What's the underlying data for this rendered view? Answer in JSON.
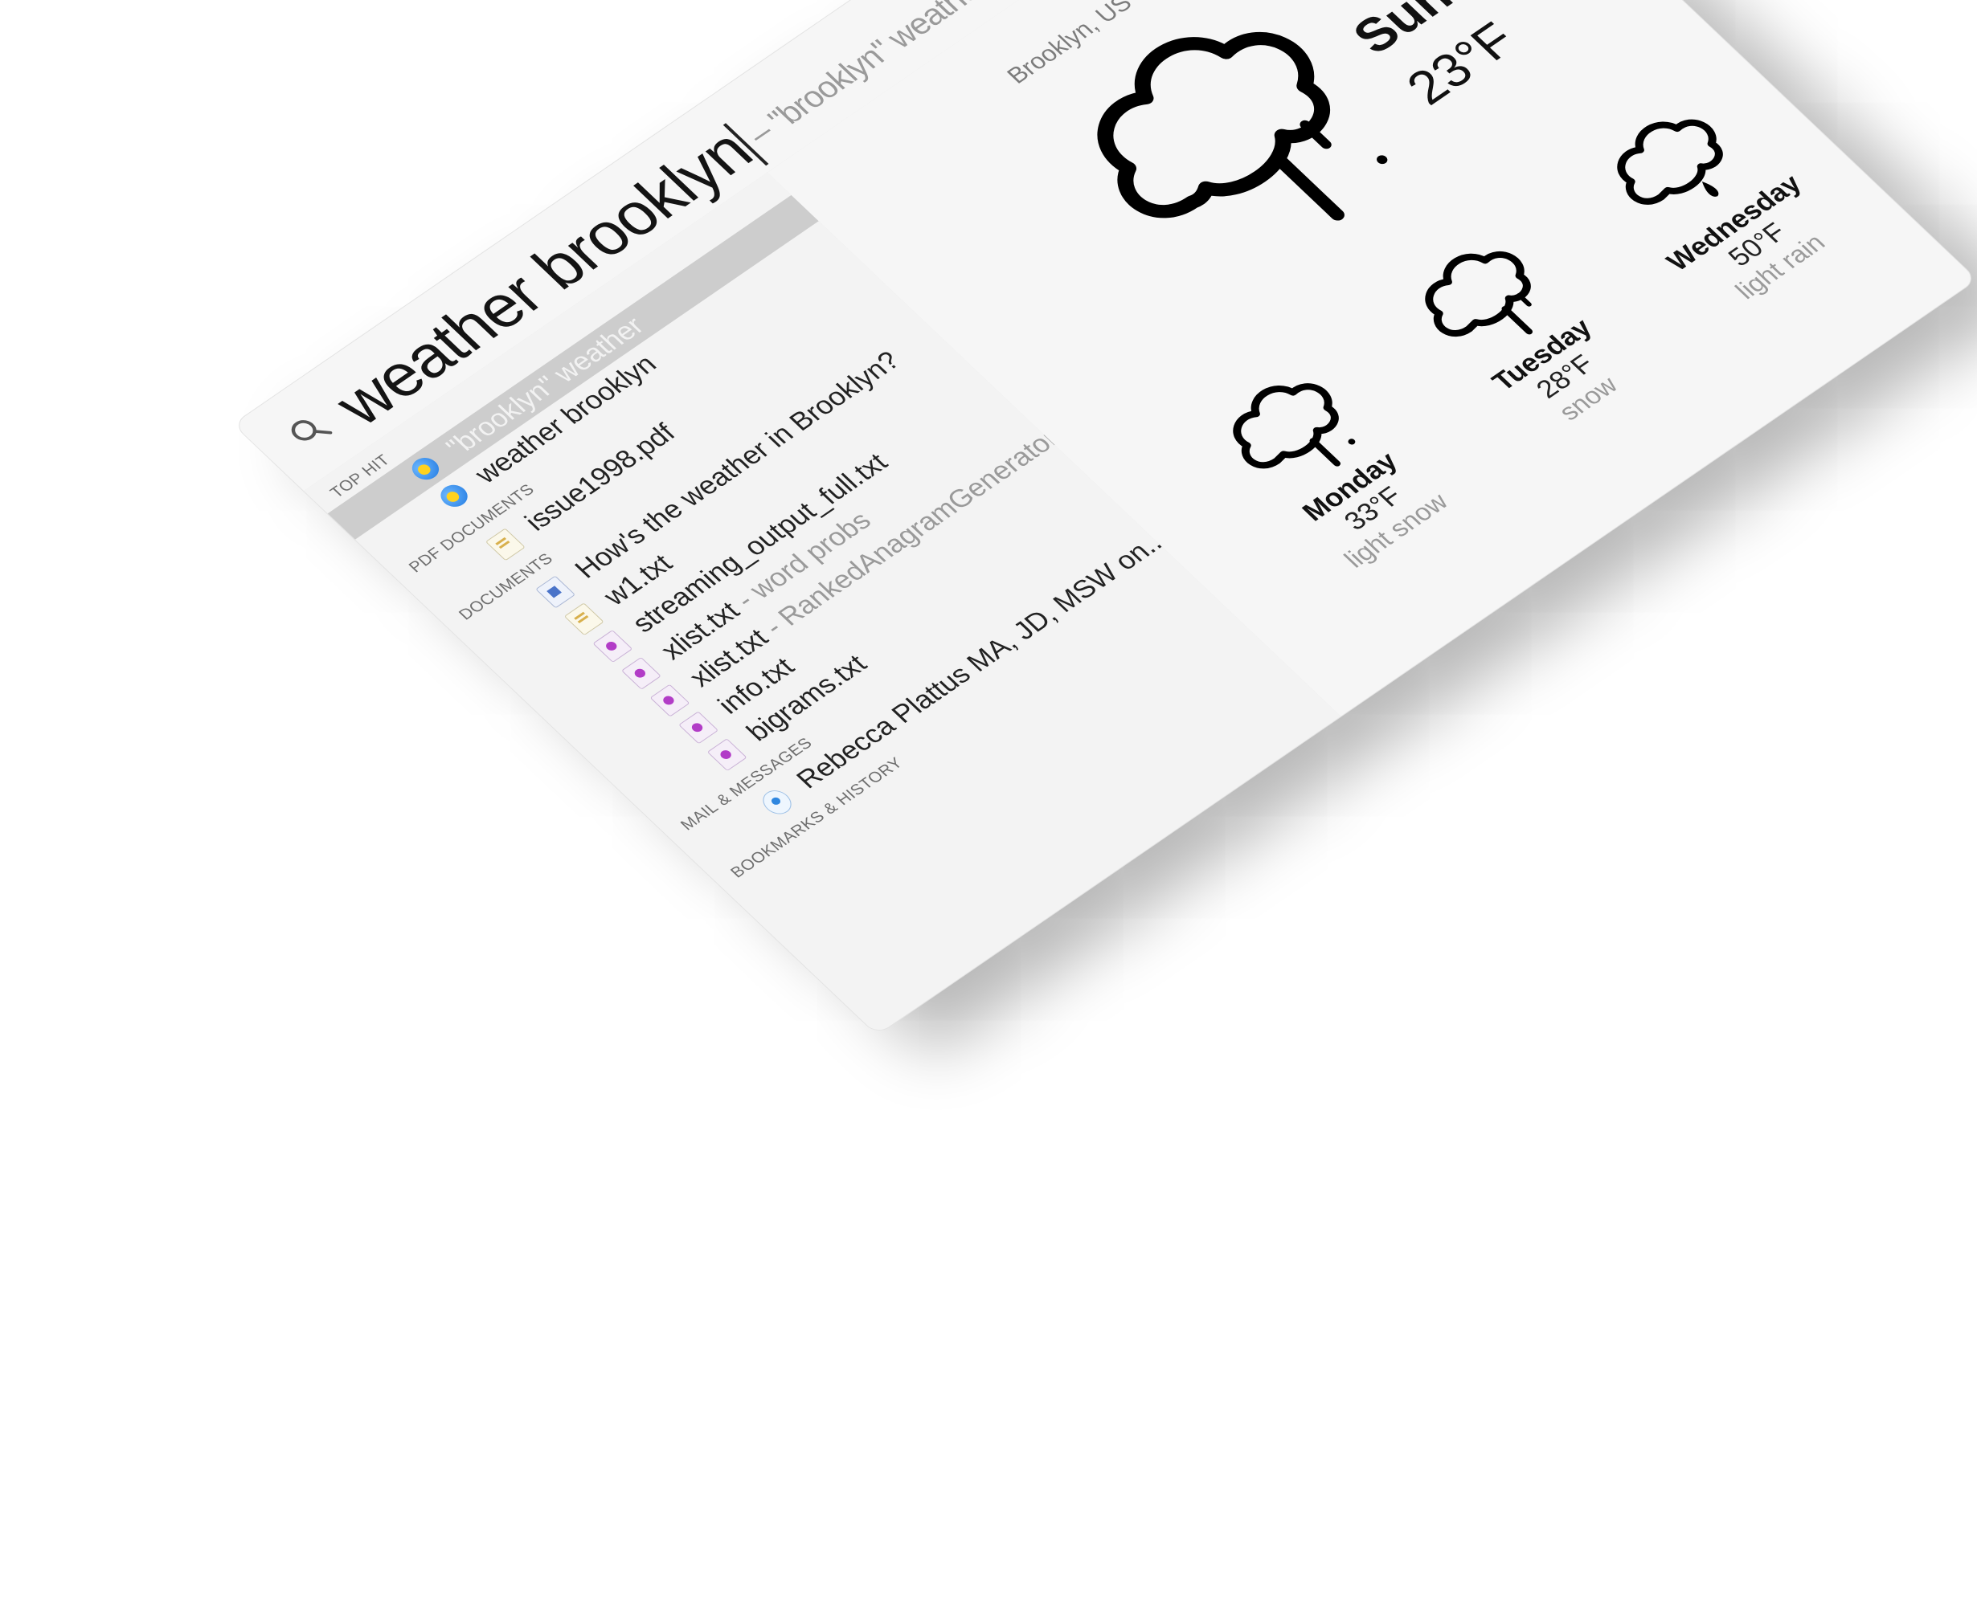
{
  "search": {
    "query": "weather brooklyn",
    "suggestion": "– \"brooklyn\" weather"
  },
  "results": {
    "sections": [
      {
        "header": "Top Hit",
        "items": [
          {
            "icon": "weather-icon",
            "primary": "",
            "secondary": "\"brooklyn\" weather",
            "selected": true
          },
          {
            "icon": "weather-icon",
            "primary": "weather brooklyn",
            "secondary": "",
            "selected": false
          }
        ]
      },
      {
        "header": "PDF Documents",
        "items": [
          {
            "icon": "pdf-icon",
            "primary": "issue1998.pdf",
            "secondary": ""
          }
        ]
      },
      {
        "header": "Documents",
        "items": [
          {
            "icon": "doc-icon",
            "primary": "How's the weather in Brooklyn?",
            "secondary": ""
          },
          {
            "icon": "pdf-icon",
            "primary": "w1.txt",
            "secondary": ""
          },
          {
            "icon": "txt-icon",
            "primary": "streaming_output_full.txt",
            "secondary": ""
          },
          {
            "icon": "txt-icon",
            "primary": "xlist.txt",
            "secondary": " - word probs"
          },
          {
            "icon": "txt-icon",
            "primary": "xlist.txt",
            "secondary": " - RankedAnagramGenerator"
          },
          {
            "icon": "txt-icon",
            "primary": "info.txt",
            "secondary": ""
          },
          {
            "icon": "txt-icon",
            "primary": "bigrams.txt",
            "secondary": ""
          }
        ]
      },
      {
        "header": "Mail & Messages",
        "items": [
          {
            "icon": "mail-icon",
            "primary": "Rebecca Plattus MA, JD, MSW on...",
            "secondary": ""
          }
        ]
      },
      {
        "header": "Bookmarks & History",
        "items": []
      }
    ]
  },
  "weather": {
    "location": "Brooklyn, US",
    "today": {
      "day": "Sunday",
      "temp": "23°F",
      "condition": "snow"
    },
    "forecast": [
      {
        "day": "Monday",
        "temp": "33°F",
        "condition": "light snow"
      },
      {
        "day": "Tuesday",
        "temp": "28°F",
        "condition": "snow"
      },
      {
        "day": "Wednesday",
        "temp": "50°F",
        "condition": "light rain"
      }
    ]
  },
  "colors": {
    "selected_row": "#cdcdcd",
    "panel_bg": "#f4f4f4",
    "secondary_text": "#9a9a9a",
    "weather_icon_blue": "#1f7fe6",
    "weather_icon_sun": "#ffd21f"
  }
}
